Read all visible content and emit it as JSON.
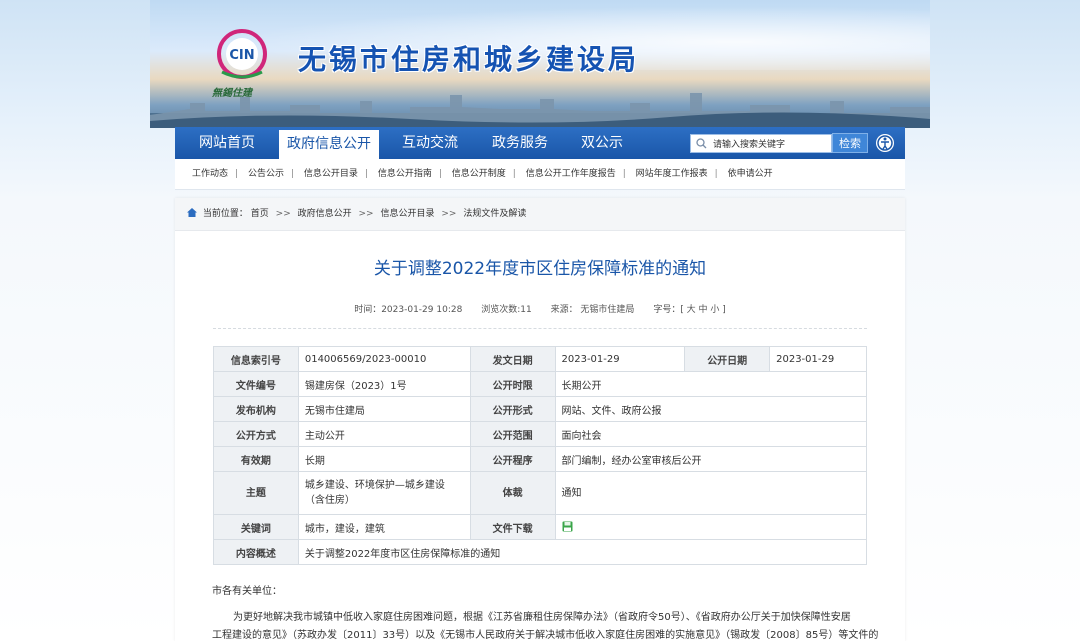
{
  "header": {
    "site_title": "无锡市住房和城乡建设局",
    "logo_text": "CIN",
    "logo_sub": "無錫住建"
  },
  "nav": {
    "items": [
      {
        "label": "网站首页"
      },
      {
        "label": "政府信息公开"
      },
      {
        "label": "互动交流"
      },
      {
        "label": "政务服务"
      },
      {
        "label": "双公示"
      }
    ],
    "search_placeholder": "请输入搜索关键字",
    "search_button": "检索"
  },
  "subnav": {
    "items": [
      "工作动态",
      "公告公示",
      "信息公开目录",
      "信息公开指南",
      "信息公开制度",
      "信息公开工作年度报告",
      "网站年度工作报表",
      "依申请公开"
    ]
  },
  "breadcrumb": {
    "label": "当前位置：",
    "items": [
      "首页",
      "政府信息公开",
      "信息公开目录",
      "法规文件及解读"
    ],
    "separator": ">>"
  },
  "article": {
    "title": "关于调整2022年度市区住房保障标准的通知",
    "time": "时间：2023-01-29 10:28",
    "views": "浏览次数:11",
    "source": "来源：  无锡市住建局",
    "font_size": "字号：[ 大 中 小 ]"
  },
  "info_table": {
    "index_no_label": "信息索引号",
    "index_no": "014006569/2023-00010",
    "issue_date_label": "发文日期",
    "issue_date": "2023-01-29",
    "publish_date_label": "公开日期",
    "publish_date": "2023-01-29",
    "doc_no_label": "文件编号",
    "doc_no": "锡建房保（2023）1号",
    "period_label": "公开时限",
    "period": "长期公开",
    "org_label": "发布机构",
    "org": "无锡市住建局",
    "form_label": "公开形式",
    "form": "网站、文件、政府公报",
    "mode_label": "公开方式",
    "mode": "主动公开",
    "scope_label": "公开范围",
    "scope": "面向社会",
    "validity_label": "有效期",
    "validity": "长期",
    "procedure_label": "公开程序",
    "procedure": "部门编制，经办公室审核后公开",
    "topic_label": "主题",
    "topic_line1": "城乡建设、环境保护—城乡建设",
    "topic_line2": "（含住房）",
    "genre_label": "体裁",
    "genre": "通知",
    "keywords_label": "关键词",
    "keywords": "城市，建设，建筑",
    "download_label": "文件下载",
    "summary_label": "内容概述",
    "summary": "关于调整2022年度市区住房保障标准的通知"
  },
  "body": {
    "salutation": "市各有关单位：",
    "para1_line1": "为更好地解决我市城镇中低收入家庭住房困难问题，根据《江苏省廉租住房保障办法》（省政府令50号）、《省政府办公厅关于加快保障性安居",
    "para1_line2": "工程建设的意见》（苏政办发〔2011〕33号）以及《无锡市人民政府关于解决城市低收入家庭住房困难的实施意见》（锡政发〔2008〕85号）等文件的"
  },
  "colors": {
    "nav_bg": "#1a56a8",
    "title_color": "#1a56a8"
  }
}
